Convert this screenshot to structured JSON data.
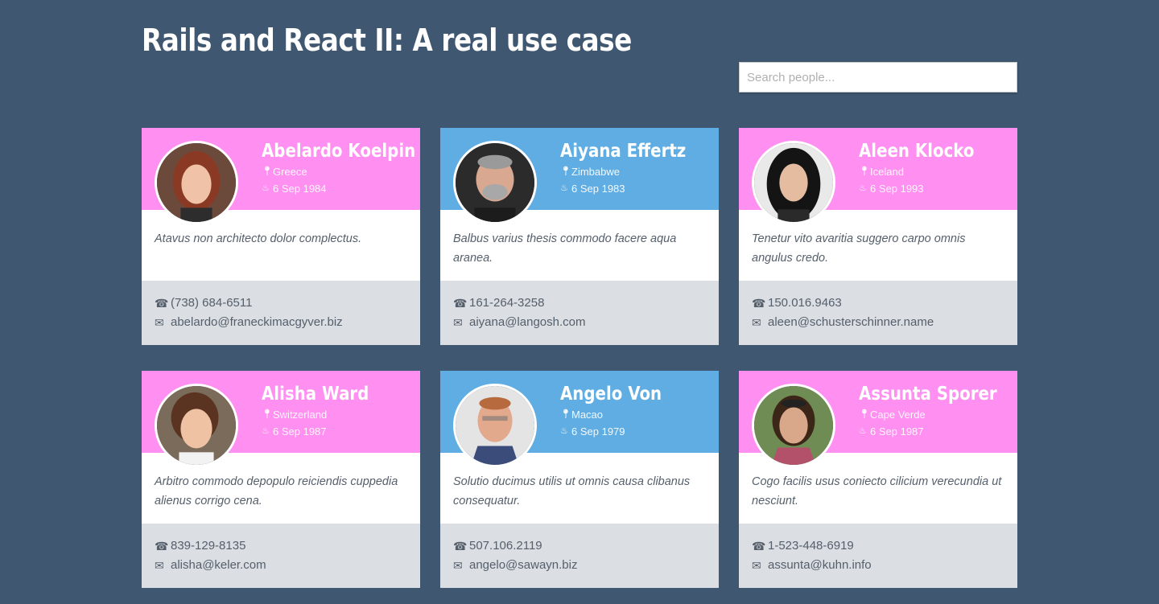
{
  "page": {
    "title": "Rails and React II: A real use case"
  },
  "search": {
    "placeholder": "Search people..."
  },
  "colors": {
    "background": "#3f5770",
    "female_header": "#ff8ff0",
    "male_header": "#5fade3",
    "footer": "#dbdee2"
  },
  "icons": {
    "location": "map-marker-icon",
    "birthday": "birthday-cake-icon",
    "phone": "phone-icon",
    "email": "envelope-icon"
  },
  "people": [
    {
      "name": "Abelardo Koelpin",
      "country": "Greece",
      "birth_date": "6 Sep 1984",
      "bio": "Atavus non architecto dolor complectus.",
      "phone": "(738) 684-6511",
      "email": "abelardo@franeckimacgyver.biz",
      "gender": "female"
    },
    {
      "name": "Aiyana Effertz",
      "country": "Zimbabwe",
      "birth_date": "6 Sep 1983",
      "bio": "Balbus varius thesis commodo facere aqua aranea.",
      "phone": "161-264-3258",
      "email": "aiyana@langosh.com",
      "gender": "male"
    },
    {
      "name": "Aleen Klocko",
      "country": "Iceland",
      "birth_date": "6 Sep 1993",
      "bio": "Tenetur vito avaritia suggero carpo omnis angulus credo.",
      "phone": "150.016.9463",
      "email": "aleen@schusterschinner.name",
      "gender": "female"
    },
    {
      "name": "Alisha Ward",
      "country": "Switzerland",
      "birth_date": "6 Sep 1987",
      "bio": "Arbitro commodo depopulo reiciendis cuppedia alienus corrigo cena.",
      "phone": "839-129-8135",
      "email": "alisha@keler.com",
      "gender": "female"
    },
    {
      "name": "Angelo Von",
      "country": "Macao",
      "birth_date": "6 Sep 1979",
      "bio": "Solutio ducimus utilis ut omnis causa clibanus consequatur.",
      "phone": "507.106.2119",
      "email": "angelo@sawayn.biz",
      "gender": "male"
    },
    {
      "name": "Assunta Sporer",
      "country": "Cape Verde",
      "birth_date": "6 Sep 1987",
      "bio": "Cogo facilis usus coniecto cilicium verecundia ut nesciunt.",
      "phone": "1-523-448-6919",
      "email": "assunta@kuhn.info",
      "gender": "female"
    }
  ]
}
